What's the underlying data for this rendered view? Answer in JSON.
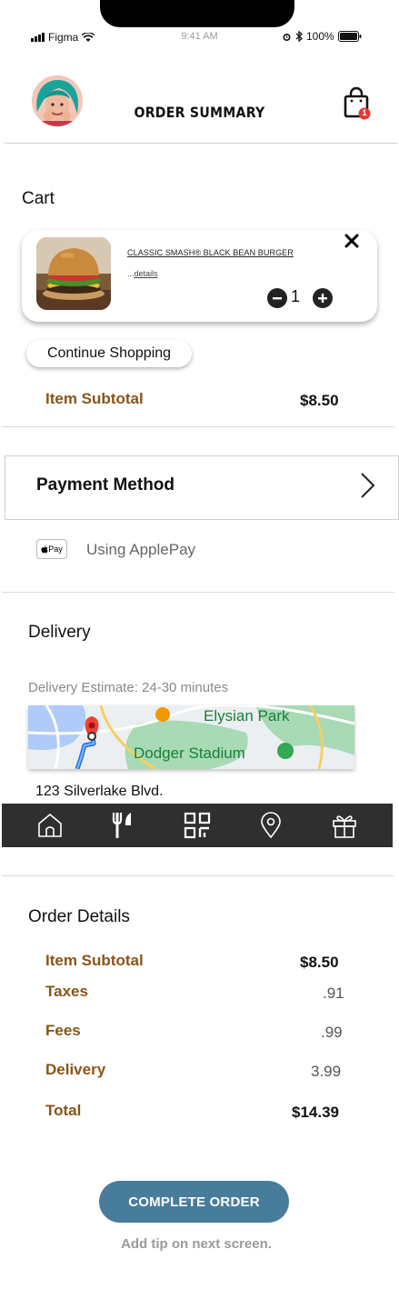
{
  "status_bar": {
    "carrier": "Figma",
    "time": "9:41 AM",
    "battery": "100%"
  },
  "header": {
    "title": "ORDER SUMMARY",
    "cart_badge_count": "1"
  },
  "cart": {
    "title": "Cart",
    "item": {
      "name": "CLASSIC SMASH® BLACK BEAN BURGER",
      "details_prefix": "...",
      "details_link": "details",
      "quantity": "1"
    },
    "continue_label": "Continue Shopping",
    "subtotal_label": "Item Subtotal",
    "subtotal_value": "$8.50"
  },
  "payment": {
    "label": "Payment Method",
    "badge": " Pay",
    "method_text": "Using ApplePay"
  },
  "delivery": {
    "title": "Delivery",
    "estimate": "Delivery Estimate: 24-30  minutes",
    "map": {
      "place_1": "Elysian Park",
      "place_2": "Dodger Stadium"
    },
    "address": "123 Silverlake Blvd."
  },
  "nav": {
    "items": [
      "home-icon",
      "restaurant-icon",
      "qr-code-icon",
      "location-pin-icon",
      "gift-icon"
    ]
  },
  "order_details": {
    "title": "Order Details",
    "rows": [
      {
        "label": "Item Subtotal",
        "value": "$8.50"
      },
      {
        "label": "Taxes",
        "value": ".91"
      },
      {
        "label": "Fees",
        "value": ".99"
      },
      {
        "label": "Delivery",
        "value": "3.99"
      },
      {
        "label": "Total",
        "value": "$14.39"
      }
    ]
  },
  "footer": {
    "complete_label": "COMPLETE ORDER",
    "tip_note": "Add tip on next screen."
  },
  "colors": {
    "accent_brown": "#8a5418",
    "button_blue": "#477d9b",
    "navbar": "#2f2f2f",
    "badge_red": "#e53935"
  }
}
